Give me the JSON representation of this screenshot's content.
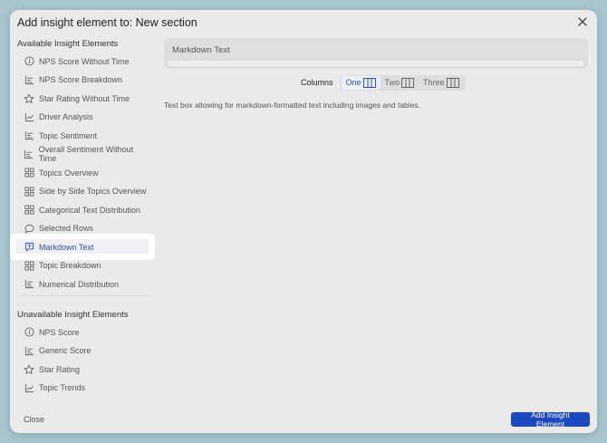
{
  "dialog": {
    "title": "Add insight element to: New section"
  },
  "sidebar": {
    "available_title": "Available Insight Elements",
    "available": [
      {
        "label": "NPS Score Without Time",
        "icon": "gauge-icon"
      },
      {
        "label": "NPS Score Breakdown",
        "icon": "bar-chart-icon"
      },
      {
        "label": "Star Rating Without Time",
        "icon": "star-icon"
      },
      {
        "label": "Driver Analysis",
        "icon": "line-chart-icon"
      },
      {
        "label": "Topic Sentiment",
        "icon": "bar-chart-icon"
      },
      {
        "label": "Overall Sentiment Without Time",
        "icon": "bar-chart-icon"
      },
      {
        "label": "Topics Overview",
        "icon": "grid-icon"
      },
      {
        "label": "Side by Side Topics Overview",
        "icon": "grid-icon"
      },
      {
        "label": "Categorical Text Distribution",
        "icon": "grid-icon"
      },
      {
        "label": "Selected Rows",
        "icon": "speech-bubble-icon"
      },
      {
        "label": "Markdown Text",
        "icon": "markdown-icon"
      },
      {
        "label": "Topic Breakdown",
        "icon": "grid-icon"
      },
      {
        "label": "Numerical Distribution",
        "icon": "bar-chart-icon"
      }
    ],
    "selected_index": 10,
    "unavailable_title": "Unavailable Insight Elements",
    "unavailable": [
      {
        "label": "NPS Score",
        "icon": "gauge-icon"
      },
      {
        "label": "Generic Score",
        "icon": "bar-chart-icon"
      },
      {
        "label": "Star Rating",
        "icon": "star-icon"
      },
      {
        "label": "Topic Trends",
        "icon": "line-chart-icon"
      }
    ]
  },
  "preview": {
    "title": "Markdown Text"
  },
  "columns": {
    "label": "Columns",
    "options": [
      "One",
      "Two",
      "Three"
    ],
    "selected": "One"
  },
  "description": "Text box allowing for markdown-formatted text including images and tables.",
  "footer": {
    "close_label": "Close",
    "add_label": "Add Insight Element"
  },
  "colors": {
    "accent": "#1c49c2",
    "selected_text": "#2b4fbf",
    "backdrop": "#a9c6cf"
  }
}
